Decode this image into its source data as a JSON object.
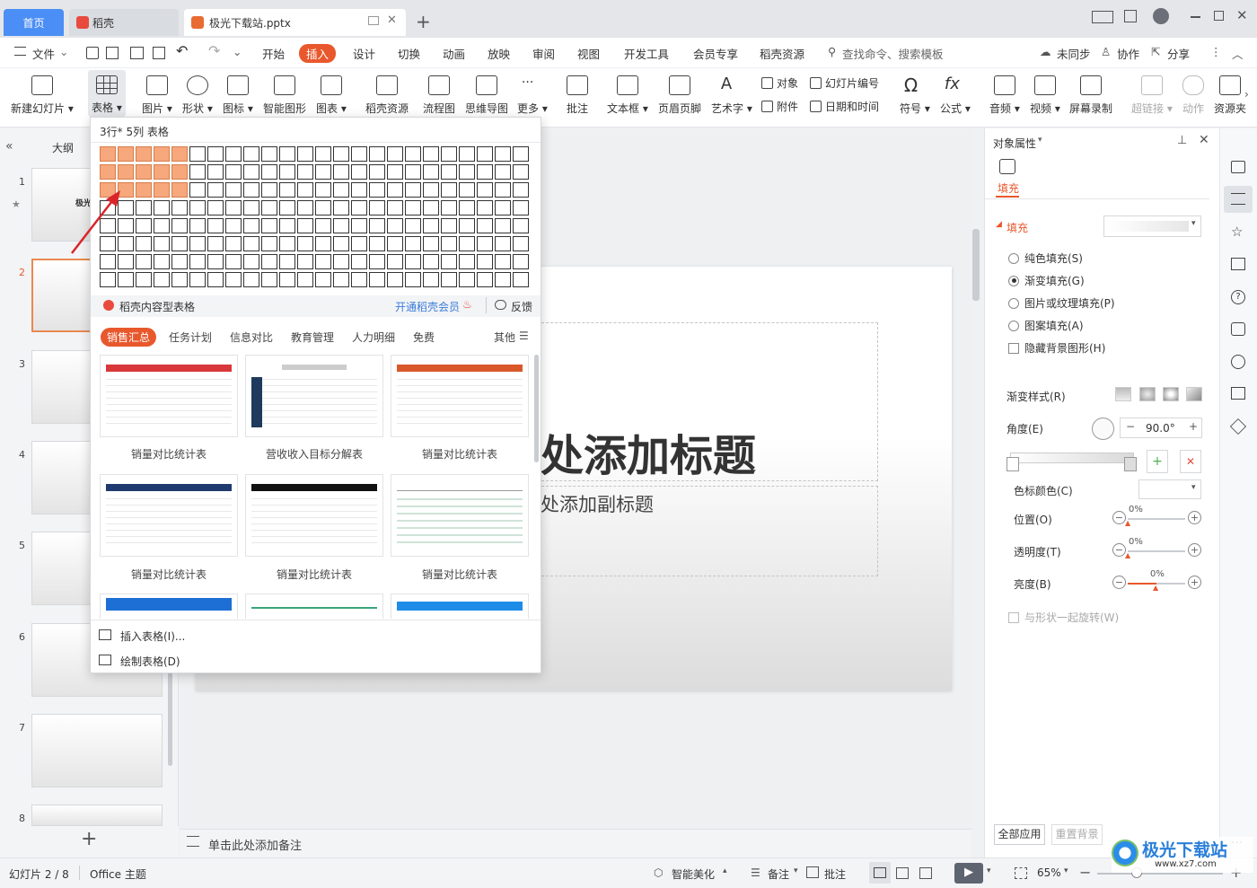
{
  "tabs": {
    "home": "首页",
    "wps": "稻壳",
    "doc": "极光下载站.pptx",
    "add": "+"
  },
  "menubar": {
    "file": "文件",
    "items": [
      "开始",
      "插入",
      "设计",
      "切换",
      "动画",
      "放映",
      "审阅",
      "视图",
      "开发工具",
      "会员专享",
      "稻壳资源"
    ],
    "search_placeholder": "查找命令、搜索模板",
    "sync": "未同步",
    "collab": "协作",
    "share": "分享"
  },
  "ribbon": {
    "new_slide": "新建幻灯片",
    "table": "表格",
    "picture": "图片",
    "shape": "形状",
    "icon": "图标",
    "smart": "智能图形",
    "chart": "图表",
    "res": "稻壳资源",
    "flow": "流程图",
    "mind": "思维导图",
    "more": "更多",
    "comment": "批注",
    "textbox": "文本框",
    "header": "页眉页脚",
    "art": "艺术字",
    "object": "对象",
    "slide_num": "幻灯片编号",
    "attach": "附件",
    "datetime": "日期和时间",
    "symbol": "符号",
    "formula": "公式",
    "audio": "音频",
    "video": "视频",
    "record": "屏幕录制",
    "link": "超链接",
    "action": "动作",
    "resource": "资源夹"
  },
  "left": {
    "outline": "大纲",
    "slide_nums": [
      "1",
      "2",
      "3",
      "4",
      "5",
      "6",
      "7",
      "8"
    ],
    "thumb1_text": "极光",
    "add": "+"
  },
  "slide": {
    "title": "处添加标题",
    "subtitle": "处添加副标题"
  },
  "notes": {
    "placeholder": "单击此处添加备注"
  },
  "dropdown": {
    "grid_label": "3行* 5列 表格",
    "grid_rows": 8,
    "grid_cols": 24,
    "selected_rows": 3,
    "selected_cols": 5,
    "section": "稻壳内容型表格",
    "vip": "开通稻壳会员",
    "feedback": "反馈",
    "categories": [
      "销售汇总",
      "任务计划",
      "信息对比",
      "教育管理",
      "人力明细",
      "免费"
    ],
    "other": "其他",
    "cards": [
      "销量对比统计表",
      "营收收入目标分解表",
      "销量对比统计表",
      "销量对比统计表",
      "销量对比统计表",
      "销量对比统计表"
    ],
    "insert_table": "插入表格(I)...",
    "draw_table": "绘制表格(D)"
  },
  "rpanel": {
    "title": "对象属性",
    "tab": "填充",
    "section": "填充",
    "options": [
      "纯色填充(S)",
      "渐变填充(G)",
      "图片或纹理填充(P)",
      "图案填充(A)"
    ],
    "hide_bg": "隐藏背景图形(H)",
    "gradient_style": "渐变样式(R)",
    "angle": "角度(E)",
    "angle_value": "90.0°",
    "stop_color": "色标颜色(C)",
    "position": "位置(O)",
    "transparency": "透明度(T)",
    "brightness": "亮度(B)",
    "pct": "0%",
    "rotate_with": "与形状一起旋转(W)",
    "apply_all": "全部应用",
    "reset_bg": "重置背景"
  },
  "status": {
    "slide_info": "幻灯片 2 / 8",
    "theme": "Office 主题",
    "beautify": "智能美化",
    "notes": "备注",
    "comments": "批注",
    "zoom": "65%"
  },
  "watermark": {
    "text": "极光下载站",
    "url": "www.xz7.com"
  },
  "colors": {
    "accent": "#e8582c",
    "tab_blue": "#4b8ef5",
    "cell_sel": "#f6a87c"
  }
}
